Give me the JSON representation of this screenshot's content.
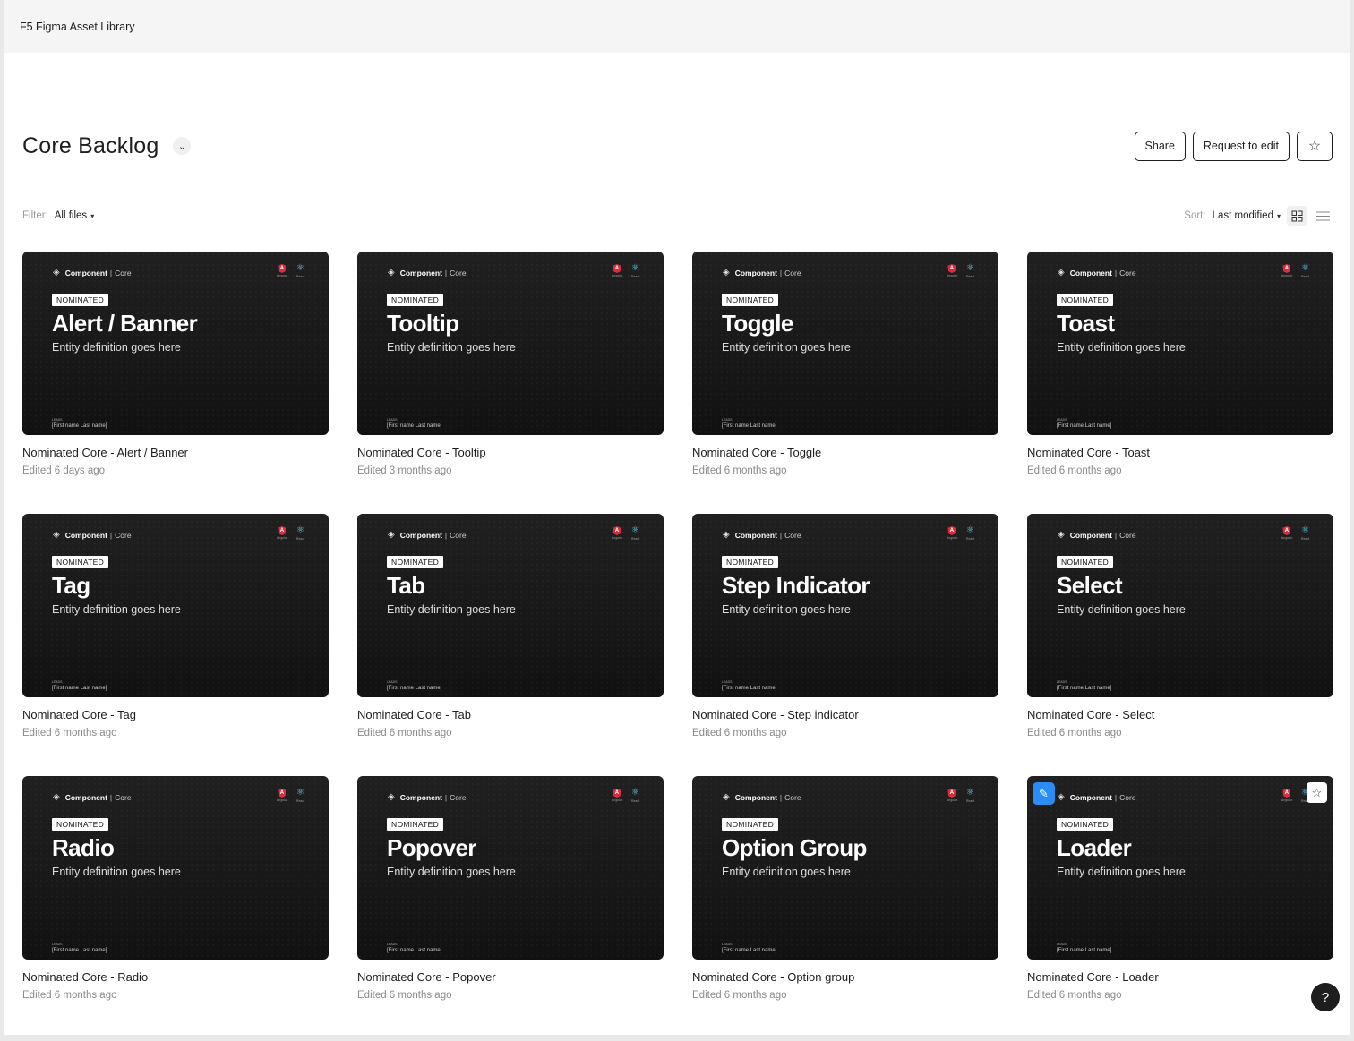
{
  "app": {
    "title": "F5 Figma Asset Library"
  },
  "header": {
    "title": "Core Backlog",
    "share_label": "Share",
    "request_label": "Request to edit"
  },
  "filter": {
    "label": "Filter:",
    "value": "All files"
  },
  "sort": {
    "label": "Sort:",
    "value": "Last modified"
  },
  "thumb_common": {
    "brand_bold": "Component",
    "brand_rest": "Core",
    "badge": "NOMINATED",
    "definition": "Entity definition goes here",
    "leads_label": "LEADS",
    "leads_name": "[First name Last name]",
    "angular_label": "Angular",
    "react_label": "React"
  },
  "files": [
    {
      "thumb_title": "Alert / Banner",
      "name": "Nominated Core - Alert / Banner",
      "edited": "Edited 6 days ago"
    },
    {
      "thumb_title": "Tooltip",
      "name": "Nominated Core - Tooltip",
      "edited": "Edited 3 months ago"
    },
    {
      "thumb_title": "Toggle",
      "name": "Nominated Core - Toggle",
      "edited": "Edited 6 months ago"
    },
    {
      "thumb_title": "Toast",
      "name": "Nominated Core - Toast",
      "edited": "Edited 6 months ago"
    },
    {
      "thumb_title": "Tag",
      "name": "Nominated Core - Tag",
      "edited": "Edited 6 months ago"
    },
    {
      "thumb_title": "Tab",
      "name": "Nominated Core - Tab",
      "edited": "Edited 6 months ago"
    },
    {
      "thumb_title": "Step Indicator",
      "name": "Nominated Core - Step indicator",
      "edited": "Edited 6 months ago"
    },
    {
      "thumb_title": "Select",
      "name": "Nominated Core - Select",
      "edited": "Edited 6 months ago"
    },
    {
      "thumb_title": "Radio",
      "name": "Nominated Core - Radio",
      "edited": "Edited 6 months ago"
    },
    {
      "thumb_title": "Popover",
      "name": "Nominated Core - Popover",
      "edited": "Edited 6 months ago"
    },
    {
      "thumb_title": "Option Group",
      "name": "Nominated Core - Option group",
      "edited": "Edited 6 months ago"
    },
    {
      "thumb_title": "Loader",
      "name": "Nominated Core - Loader",
      "edited": "Edited 6 months ago",
      "hovered": true
    }
  ],
  "help": {
    "label": "?"
  }
}
